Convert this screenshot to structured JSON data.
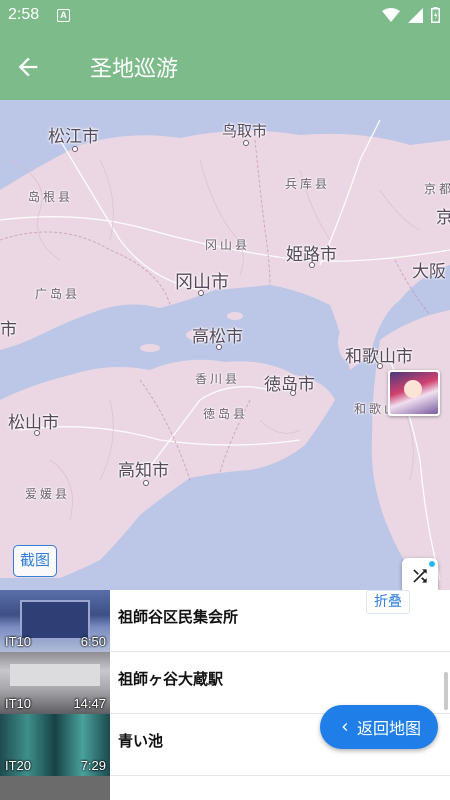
{
  "status_bar": {
    "time": "2:58",
    "notification_letter": "A"
  },
  "app_bar": {
    "title": "圣地巡游",
    "background": "#7dbb8a"
  },
  "map": {
    "cities": {
      "matsue": "松江市",
      "tottori": "鸟取市",
      "himeji": "姫路市",
      "okayama": "冈山市",
      "takamatsu": "高松市",
      "tokushima": "徳岛市",
      "wakayama": "和歌山市",
      "matsuyama": "松山市",
      "kochi": "高知市",
      "left_edge": "市",
      "osaka_partial": "大阪"
    },
    "prefectures": {
      "shimane": "岛根县",
      "hyogo": "兵库县",
      "kyoto_partial": "京都",
      "kyoto_char": "京",
      "okayama": "冈山县",
      "hiroshima": "广岛县",
      "kagawa": "香川县",
      "tokushima": "徳岛县",
      "wakayama": "和歌山县",
      "ehime": "爱媛县"
    },
    "screenshot_button": "截图"
  },
  "panel": {
    "collapse_label": "折叠",
    "return_label": "返回地图"
  },
  "locations": [
    {
      "name": "祖師谷区民集会所",
      "episode": "IT10",
      "timestamp": "6:50"
    },
    {
      "name": "祖師ヶ谷大蔵駅",
      "episode": "IT10",
      "timestamp": "14:47"
    },
    {
      "name": "青い池",
      "episode": "IT20",
      "timestamp": "7:29"
    }
  ],
  "colors": {
    "accent": "#1f7ee8",
    "sea": "#bcc6e6",
    "land": "#ead7e3"
  }
}
